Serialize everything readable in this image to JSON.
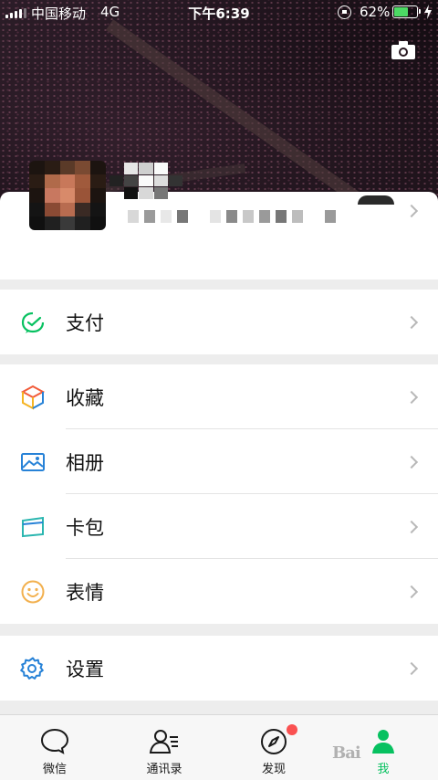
{
  "status_bar": {
    "carrier": "中国移动",
    "network": "4G",
    "time": "下午6:39",
    "battery_percent": "62%",
    "battery_level": 0.62,
    "battery_color": "#4cd964"
  },
  "cover": {
    "camera_icon": "camera-icon"
  },
  "menu_groups": [
    [
      {
        "label": "支付",
        "icon": "pay-icon",
        "color": "#07c160"
      }
    ],
    [
      {
        "label": "收藏",
        "icon": "favorites-cube-icon",
        "color": "#f5a623"
      },
      {
        "label": "相册",
        "icon": "album-icon",
        "color": "#2782d7"
      },
      {
        "label": "卡包",
        "icon": "card-wallet-icon",
        "color": "#2bb6b0"
      },
      {
        "label": "表情",
        "icon": "emoji-icon",
        "color": "#f2b04e"
      }
    ],
    [
      {
        "label": "设置",
        "icon": "settings-gear-icon",
        "color": "#2782d7"
      }
    ]
  ],
  "tabs": [
    {
      "label": "微信",
      "icon": "chat-bubble-icon"
    },
    {
      "label": "通讯录",
      "icon": "contacts-icon"
    },
    {
      "label": "发现",
      "icon": "compass-icon",
      "has_badge": true
    },
    {
      "label": "我",
      "icon": "me-person-icon",
      "active": true
    }
  ],
  "colors": {
    "accent": "#07c160",
    "badge": "#fa5151"
  },
  "watermark": "Bai"
}
